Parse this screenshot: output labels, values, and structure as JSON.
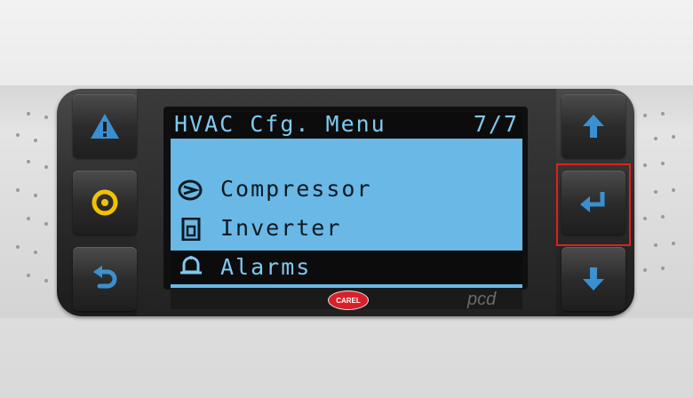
{
  "screen": {
    "title": "HVAC Cfg. Menu",
    "page_indicator": "7/7",
    "items": [
      {
        "label": "Compressor",
        "icon": "compressor-icon",
        "selected": false
      },
      {
        "label": "Inverter",
        "icon": "inverter-icon",
        "selected": false
      },
      {
        "label": "Alarms",
        "icon": "alarm-bell-icon",
        "selected": true
      }
    ]
  },
  "brand": {
    "logo": "CAREL",
    "model": "pcd"
  },
  "buttons": {
    "left": [
      "alarm-button",
      "program-button",
      "escape-button"
    ],
    "right": [
      "up-button",
      "enter-button",
      "down-button"
    ]
  },
  "colors": {
    "lcd_background": "#69b8e6",
    "lcd_text": "#0c1a22",
    "alarm_icon": "#3a8fd0",
    "program_icon": "#f2c200",
    "nav_icon": "#3a8fd0",
    "highlight_border": "#e0201a"
  }
}
